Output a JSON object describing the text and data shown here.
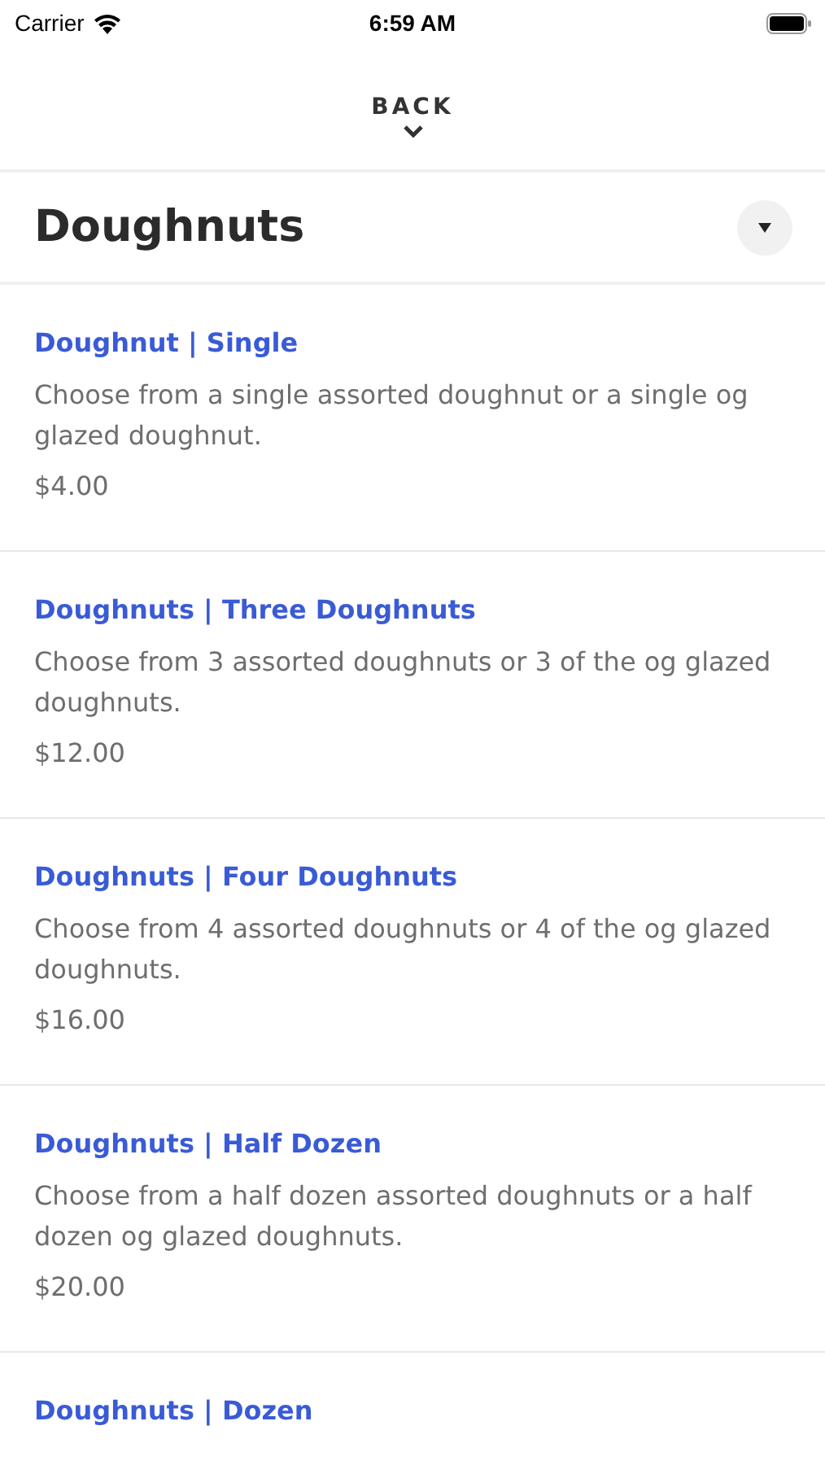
{
  "status_bar": {
    "carrier": "Carrier",
    "time": "6:59 AM"
  },
  "back": {
    "label": "BACK"
  },
  "section": {
    "title": "Doughnuts",
    "expanded": true
  },
  "items": [
    {
      "title": "Doughnut | Single",
      "description": "Choose from a single assorted doughnut or a single og glazed doughnut.",
      "price": "$4.00"
    },
    {
      "title": "Doughnuts | Three Doughnuts",
      "description": "Choose from 3 assorted doughnuts or 3 of the og glazed doughnuts.",
      "price": "$12.00"
    },
    {
      "title": "Doughnuts | Four Doughnuts",
      "description": "Choose from 4 assorted doughnuts or 4 of the og glazed doughnuts.",
      "price": "$16.00"
    },
    {
      "title": "Doughnuts | Half Dozen",
      "description": "Choose from a half dozen assorted doughnuts or a half dozen og glazed doughnuts.",
      "price": "$20.00"
    },
    {
      "title": "Doughnuts | Dozen"
    }
  ]
}
